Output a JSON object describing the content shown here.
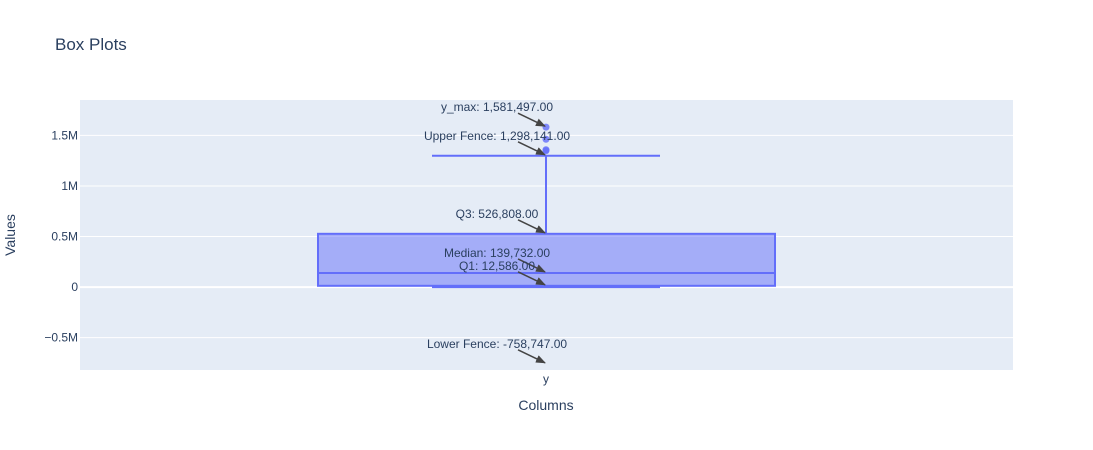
{
  "chart_data": {
    "type": "box",
    "title": "Box Plots",
    "xlabel": "Columns",
    "ylabel": "Values",
    "categories": [
      "y"
    ],
    "ylim": [
      -820000,
      1850000
    ],
    "yticks": [
      {
        "value": -500000,
        "label": "−0.5M"
      },
      {
        "value": 0,
        "label": "0"
      },
      {
        "value": 500000,
        "label": "0.5M"
      },
      {
        "value": 1000000,
        "label": "1M"
      },
      {
        "value": 1500000,
        "label": "1.5M"
      }
    ],
    "box": {
      "q1": 12586,
      "median": 139732,
      "q3": 526808,
      "upper_whisker": 1298141,
      "lower_whisker": 0,
      "outliers": [
        1348000,
        1358000,
        1462000,
        1581497
      ]
    },
    "annotations": [
      {
        "text": "y_max: 1,581,497.00",
        "value": 1581497
      },
      {
        "text": "Upper Fence: 1,298,141.00",
        "value": 1298141
      },
      {
        "text": "Q3: 526,808.00",
        "value": 526808
      },
      {
        "text": "Median: 139,732.00",
        "value": 139732
      },
      {
        "text": "Q1: 12,586.00",
        "value": 12586
      },
      {
        "text": "Lower Fence: -758,747.00",
        "value": -758747
      }
    ],
    "colors": {
      "plot_bg": "#e5ecf6",
      "grid": "#ffffff",
      "box_line": "#636efa",
      "box_fill": "rgba(99,110,250,0.5)",
      "arrow": "#444444",
      "text": "#2a3f5f"
    }
  }
}
